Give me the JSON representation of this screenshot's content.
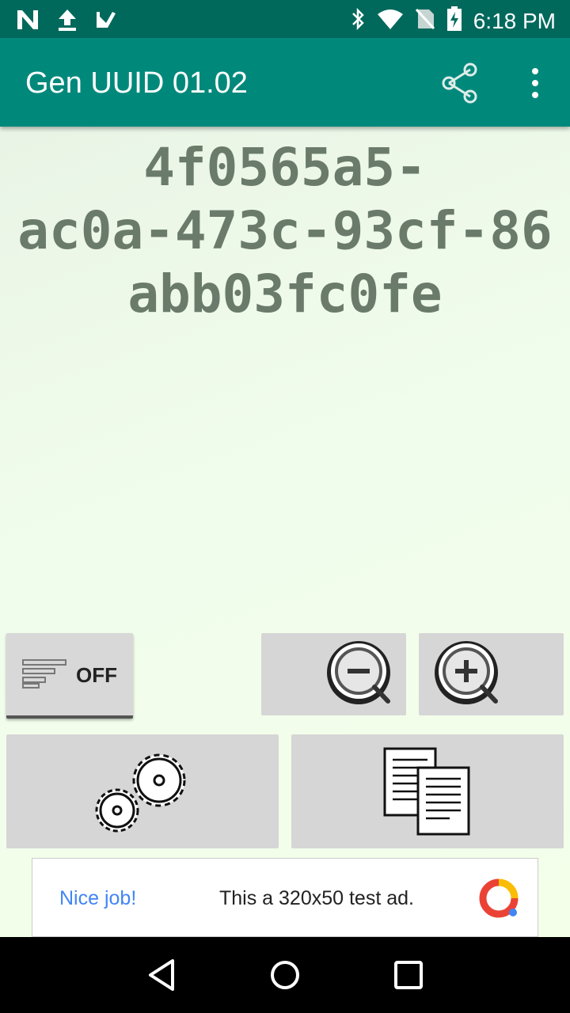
{
  "status_bar": {
    "time": "6:18 PM",
    "left_icons": [
      "n-notification-icon",
      "upload-icon",
      "task-check-icon"
    ],
    "right_icons": [
      "bluetooth-icon",
      "wifi-icon",
      "no-sim-icon",
      "battery-charging-icon"
    ]
  },
  "app_bar": {
    "title": "Gen UUID 01.02",
    "color": "#00897b",
    "status_color": "#00695c"
  },
  "uuid": {
    "line1": "4f0565a5-",
    "line2": "ac0a-473c-93cf-86",
    "line3": "abb03fc0fe",
    "color": "#6b7b6b"
  },
  "controls": {
    "format_toggle_label": "OFF",
    "icons": [
      "format-list-icon",
      "zoom-out-icon",
      "zoom-in-icon",
      "settings-gears-icon",
      "copy-documents-icon"
    ]
  },
  "ad": {
    "nice_job": "Nice job!",
    "text": "This a 320x50 test ad."
  },
  "nav_bar": {
    "icons": [
      "back-icon",
      "home-icon",
      "recents-icon"
    ]
  }
}
